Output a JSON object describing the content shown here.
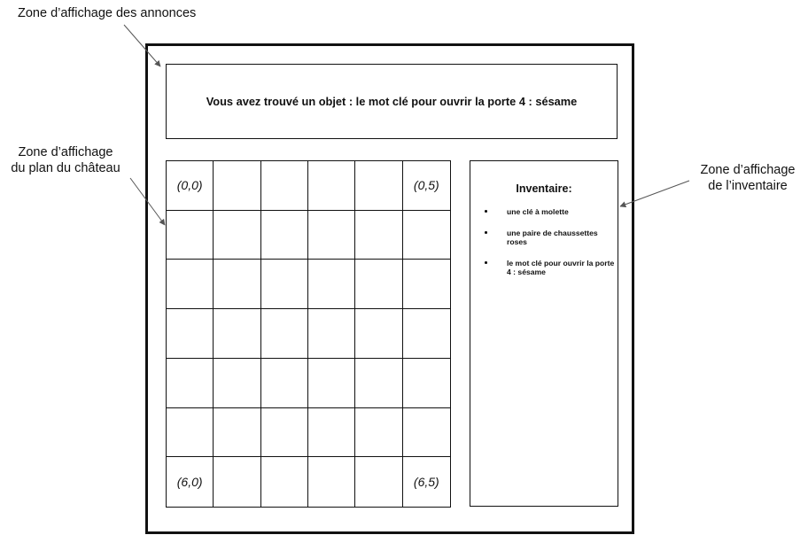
{
  "labels": {
    "annonces": "Zone d’affichage des annonces",
    "plan_line1": "Zone d’affichage",
    "plan_line2": "du plan du château",
    "inventaire_line1": "Zone d’affichage",
    "inventaire_line2": "de l’inventaire"
  },
  "announcement": "Vous avez trouvé un objet : le mot clé pour ouvrir la porte 4 : sésame",
  "grid": {
    "rows": 7,
    "cols": 6,
    "corner_labels": {
      "top_left": "(0,0)",
      "top_right": "(0,5)",
      "bottom_left": "(6,0)",
      "bottom_right": "(6,5)"
    }
  },
  "inventory": {
    "title": "Inventaire:",
    "items": [
      "une clé à molette",
      "une paire de chaussettes roses",
      "le mot clé pour ouvrir la porte 4 : sésame"
    ]
  },
  "colors": {
    "line": "#111111",
    "arrow": "#555555",
    "background": "#ffffff"
  }
}
